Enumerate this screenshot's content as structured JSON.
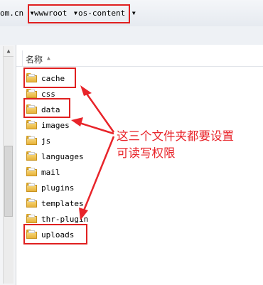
{
  "breadcrumb": {
    "domain_fragment": "om.cn",
    "segments": [
      "wwwroot",
      "os-content"
    ]
  },
  "file_list": {
    "name_column": "名称",
    "items": [
      {
        "label": "cache",
        "highlight": true
      },
      {
        "label": "css",
        "highlight": false
      },
      {
        "label": "data",
        "highlight": true
      },
      {
        "label": "images",
        "highlight": false
      },
      {
        "label": "js",
        "highlight": false
      },
      {
        "label": "languages",
        "highlight": false
      },
      {
        "label": "mail",
        "highlight": false
      },
      {
        "label": "plugins",
        "highlight": false
      },
      {
        "label": "templates",
        "highlight": false
      },
      {
        "label": "thr-plugin",
        "highlight": false
      },
      {
        "label": "uploads",
        "highlight": true
      }
    ]
  },
  "annotation": {
    "text_line1": "这三个文件夹都要设置",
    "text_line2": "可读写权限",
    "color": "#e8242a"
  }
}
